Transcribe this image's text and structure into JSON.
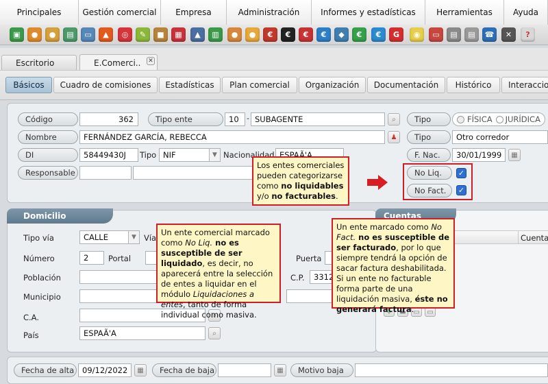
{
  "menu": [
    "Principales",
    "Gestión comercial",
    "Empresa",
    "Administración",
    "Informes y estadísticas",
    "Herramientas",
    "Ayuda"
  ],
  "tabs": [
    {
      "label": "Escritorio"
    },
    {
      "label": "E.Comerci.."
    }
  ],
  "subnav": [
    "Básicos",
    "Cuadro de comisiones",
    "Estadísticas",
    "Plan comercial",
    "Organización",
    "Documentación",
    "Histórico",
    "Interacciones"
  ],
  "form": {
    "codigo_label": "Código",
    "codigo_value": "362",
    "tipo_ente_label": "Tipo ente",
    "tipo_ente_code": "10",
    "tipo_ente_dash": "-",
    "tipo_ente_value": "SUBAGENTE",
    "tipo_label": "Tipo",
    "tipo_fisica": "FÍSICA",
    "tipo_juridica": "JURÍDICA",
    "nombre_label": "Nombre",
    "nombre_value": "FERNÁNDEZ GARCÍA, REBECCA",
    "tipo2_label": "Tipo",
    "tipo2_value": "Otro corredor",
    "di_label": "DI",
    "di_value": "58449430J",
    "di_tipo_label": "Tipo",
    "di_tipo_value": "NIF",
    "nacionalidad_label": "Nacionalidad",
    "nacionalidad_value": "ESPAÃ'A",
    "fnac_label": "F. Nac.",
    "fnac_value": "30/01/1999",
    "responsable_label": "Responsable",
    "noliq_label": "No Liq.",
    "nofact_label": "No Fact."
  },
  "domicilio": {
    "title": "Domicilio",
    "tipovia_label": "Tipo vía",
    "tipovia_value": "CALLE",
    "via_label": "Vía",
    "numero_label": "Número",
    "numero_value": "2",
    "portal_label": "Portal",
    "puerta_label": "Puerta",
    "poblacion_label": "Población",
    "cp_label": "C.P.",
    "cp_value": "3312",
    "municipio_label": "Municipio",
    "ca_label": "C.A.",
    "pais_label": "País",
    "pais_value": "ESPAÃ'A"
  },
  "cuentas": {
    "title": "Cuentas",
    "col": "Cuenta"
  },
  "bottom": {
    "alta_label": "Fecha de alta",
    "alta_value": "09/12/2022",
    "baja_label": "Fecha de baja",
    "motivo_label": "Motivo baja"
  },
  "notes": {
    "n1_a": "Los entes comerciales pueden categorizarse como ",
    "n1_b": "no liquidables",
    "n1_c": " y/o ",
    "n1_d": "no facturables",
    "n1_e": ".",
    "n2_a": "Un ente comercial marcado como ",
    "n2_b": "No Liq.",
    "n2_c": " no es susceptible de ser liquidado",
    "n2_d": ", es decir, no aparecerá entre la selección de entes a liquidar en el módulo ",
    "n2_e": "Liquidaciones a entes",
    "n2_f": ", tanto de forma individual como masiva.",
    "n3_a": "Un ente marcado como ",
    "n3_b": "No Fact.",
    "n3_c": " no es susceptible de ser facturado",
    "n3_d": ", por lo que siempre tendrá la opción de sacar factura deshabilitada. Si un ente no facturable forma parte de una liquidación masiva, ",
    "n3_e": "éste no generará factura",
    "n3_f": "."
  },
  "icons": [
    "cube-icon",
    "user-icon",
    "users-icon",
    "screen-icon",
    "window-icon",
    "fire-icon",
    "target-icon",
    "pencil-icon",
    "briefcase-icon",
    "gift-icon",
    "hat-icon",
    "calculator-icon",
    "person-icon",
    "person2-icon",
    "money-icon",
    "euro-dark-icon",
    "no-euro-icon",
    "euro-blue-icon",
    "diamond-icon",
    "euro-green-icon",
    "euro-circle-icon",
    "g-icon",
    "bulb-icon",
    "card-icon",
    "doc-icon",
    "doc2-icon",
    "phone-icon",
    "tools-icon",
    "help-icon"
  ],
  "colors": {
    "accent": "#2f6fd1",
    "note_border": "#d21d27",
    "note_bg": "#fff6c6",
    "section": "#6b8598"
  }
}
